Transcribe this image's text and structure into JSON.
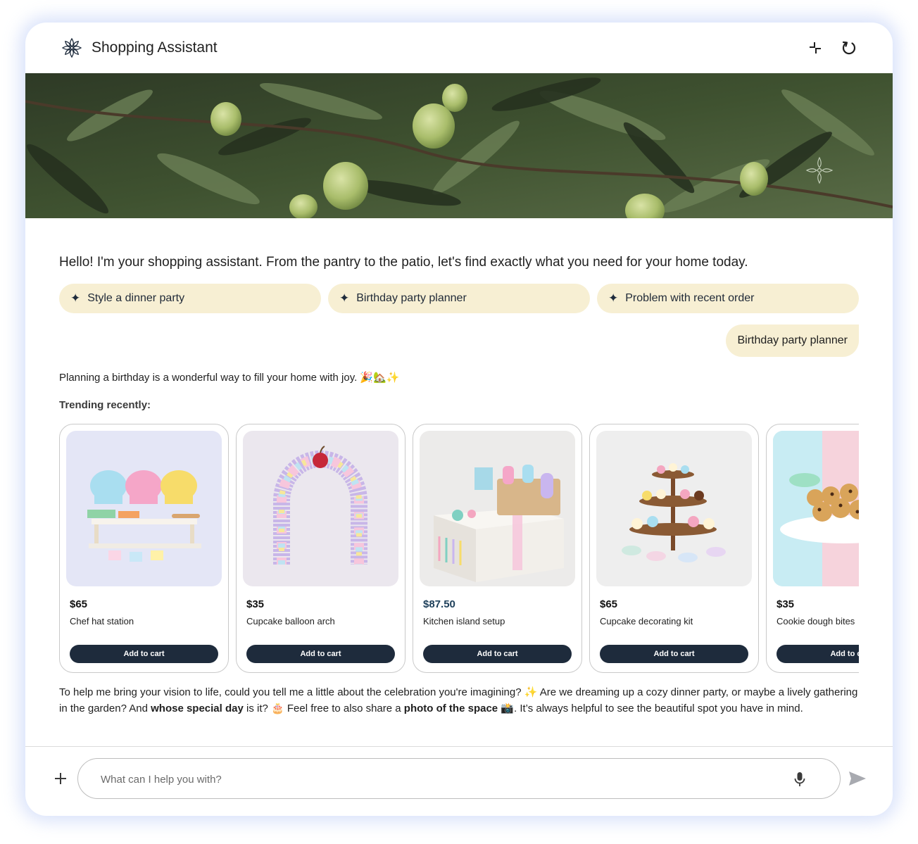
{
  "app": {
    "title": "Shopping Assistant"
  },
  "header": {
    "logo_icon": "flower-logo-icon",
    "minimize_icon": "minimize-icon",
    "reset_icon": "refresh-icon"
  },
  "chat": {
    "greeting": "Hello! I'm your shopping assistant. From the pantry to the patio, let's find exactly what you need for your home today.",
    "suggestions": [
      {
        "label": "Style a dinner party"
      },
      {
        "label": "Birthday party planner"
      },
      {
        "label": "Problem with recent order"
      }
    ],
    "user_message": "Birthday party planner",
    "assistant_intro": "Planning a birthday is a wonderful way to fill your home with joy. 🎉🏡✨",
    "trending_heading": "Trending recently:",
    "products": [
      {
        "price": "$65",
        "name": "Chef hat station",
        "button": "Add to cart"
      },
      {
        "price": "$35",
        "name": "Cupcake balloon arch",
        "button": "Add to cart"
      },
      {
        "price": "$87.50",
        "name": "Kitchen island setup",
        "button": "Add to cart"
      },
      {
        "price": "$65",
        "name": "Cupcake decorating kit",
        "button": "Add to cart"
      },
      {
        "price": "$35",
        "name": "Cookie dough bites",
        "button": "Add to cart"
      }
    ],
    "followup": {
      "part1": "To help me bring your vision to life, could you tell me a little about the celebration you're imagining? ✨ Are we dreaming up a cozy dinner party, or maybe a lively gathering in the garden? And ",
      "bold1": "whose special day",
      "part2": " is it? 🎂 Feel free to also share a ",
      "bold2": "photo of the space",
      "part3": " 📸. It’s always helpful to see the beautiful spot you have in mind."
    }
  },
  "composer": {
    "placeholder": "What can I help you with?",
    "value": "",
    "add_icon": "plus-icon",
    "mic_icon": "microphone-icon",
    "send_icon": "send-icon"
  },
  "colors": {
    "chip_bg": "#f7efd3",
    "button_bg": "#1e2b3c",
    "frame_glow": "#aabef5"
  }
}
